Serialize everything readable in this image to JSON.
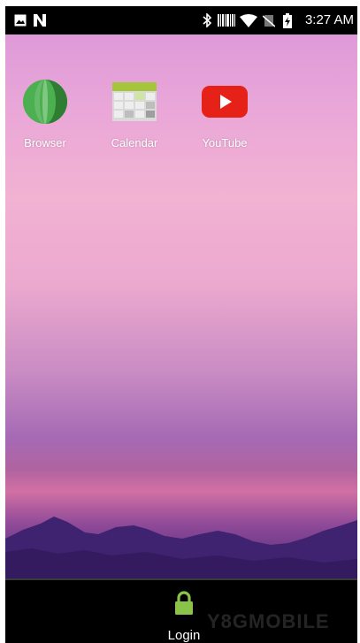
{
  "status_bar": {
    "time": "3:27 AM",
    "left_icons": [
      "image-notification-icon",
      "n-notification-icon"
    ],
    "right_icons": [
      "bluetooth-icon",
      "barcode-icon",
      "wifi-icon",
      "no-sim-icon",
      "battery-charging-icon"
    ]
  },
  "apps": [
    {
      "label": "Browser",
      "icon": "browser-icon"
    },
    {
      "label": "Calendar",
      "icon": "calendar-icon"
    },
    {
      "label": "YouTube",
      "icon": "youtube-icon"
    }
  ],
  "login_bar": {
    "label": "Login",
    "icon": "lock-icon",
    "accent_color": "#8bc34a"
  },
  "watermark": "Y8GMOBILE"
}
